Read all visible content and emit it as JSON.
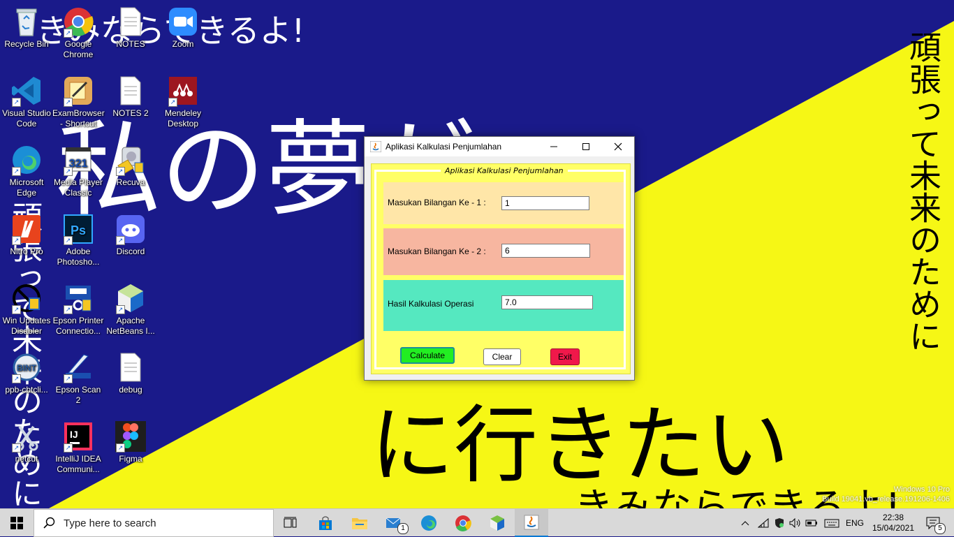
{
  "wallpaper": {
    "colors": {
      "blue": "#1a1a8a",
      "yellow": "#f6f715"
    },
    "text_top": "きみならできるよ!",
    "text_big": "私の夢が",
    "text_bottom": "に行きたい",
    "text_bottom_right": "きみならできるよ!",
    "text_vertical_right": "頑張って未来のために",
    "text_vertical_left": "頑張って未来のために"
  },
  "desktop_icons": [
    {
      "label": "Recycle Bin",
      "icon": "recycle-bin-icon"
    },
    {
      "label": "Google Chrome",
      "icon": "chrome-icon"
    },
    {
      "label": "NOTES",
      "icon": "text-file-icon"
    },
    {
      "label": "Zoom",
      "icon": "zoom-icon"
    },
    {
      "label": "Visual Studio Code",
      "icon": "vscode-icon"
    },
    {
      "label": "ExamBrowser - Shortcut",
      "icon": "exambrowser-icon"
    },
    {
      "label": "NOTES 2",
      "icon": "text-file-icon"
    },
    {
      "label": "Mendeley Desktop",
      "icon": "mendeley-icon"
    },
    {
      "label": "Microsoft Edge",
      "icon": "edge-icon"
    },
    {
      "label": "Media Player Classic",
      "icon": "media-player-icon"
    },
    {
      "label": "Recuva",
      "icon": "recuva-icon"
    },
    {
      "label": "Nitro Pro",
      "icon": "nitro-icon"
    },
    {
      "label": "Adobe Photosho...",
      "icon": "photoshop-icon"
    },
    {
      "label": "Discord",
      "icon": "discord-icon"
    },
    {
      "label": "Win Updates Disabler",
      "icon": "win-updates-disabler-icon"
    },
    {
      "label": "Epson Printer Connectio...",
      "icon": "epson-printer-icon"
    },
    {
      "label": "Apache NetBeans I...",
      "icon": "netbeans-icon"
    },
    {
      "label": "ppb-cbtcli...",
      "icon": "ppb-cbt-icon"
    },
    {
      "label": "Epson Scan 2",
      "icon": "epson-scan-icon"
    },
    {
      "label": "debug",
      "icon": "text-file-icon"
    },
    {
      "label": "netcut",
      "icon": "netcut-icon"
    },
    {
      "label": "IntelliJ IDEA Communi...",
      "icon": "intellij-icon"
    },
    {
      "label": "Figma",
      "icon": "figma-icon"
    }
  ],
  "window": {
    "title": "Aplikasi Kalkulasi Penjumlahan",
    "frame_title": "Aplikasi Kalkulasi Penjumlahan",
    "row1": {
      "label": "Masukan Bilangan Ke - 1 :",
      "value": "1",
      "color": "#ffe6a8"
    },
    "row2": {
      "label": "Masukan Bilangan Ke - 2 :",
      "value": "6",
      "color": "#f7b6a0"
    },
    "row3": {
      "label": "Hasil Kalkulasi Operasi",
      "value": "7.0",
      "color": "#55e8c0"
    },
    "buttons": {
      "calculate": {
        "label": "Calculate",
        "color": "#22ee22"
      },
      "clear": {
        "label": "Clear",
        "color": "#ffffff"
      },
      "exit": {
        "label": "Exit",
        "color": "#f0184a"
      }
    },
    "panel_color": "#ffff66"
  },
  "taskbar": {
    "search_placeholder": "Type here to search",
    "mail_badge": "1",
    "language": "ENG",
    "time": "22:38",
    "date": "15/04/2021",
    "notification_count": "5"
  },
  "watermark": {
    "line1": "Windows 10 Pro",
    "line2": "Build 19041.vb_release.191206-1406"
  }
}
